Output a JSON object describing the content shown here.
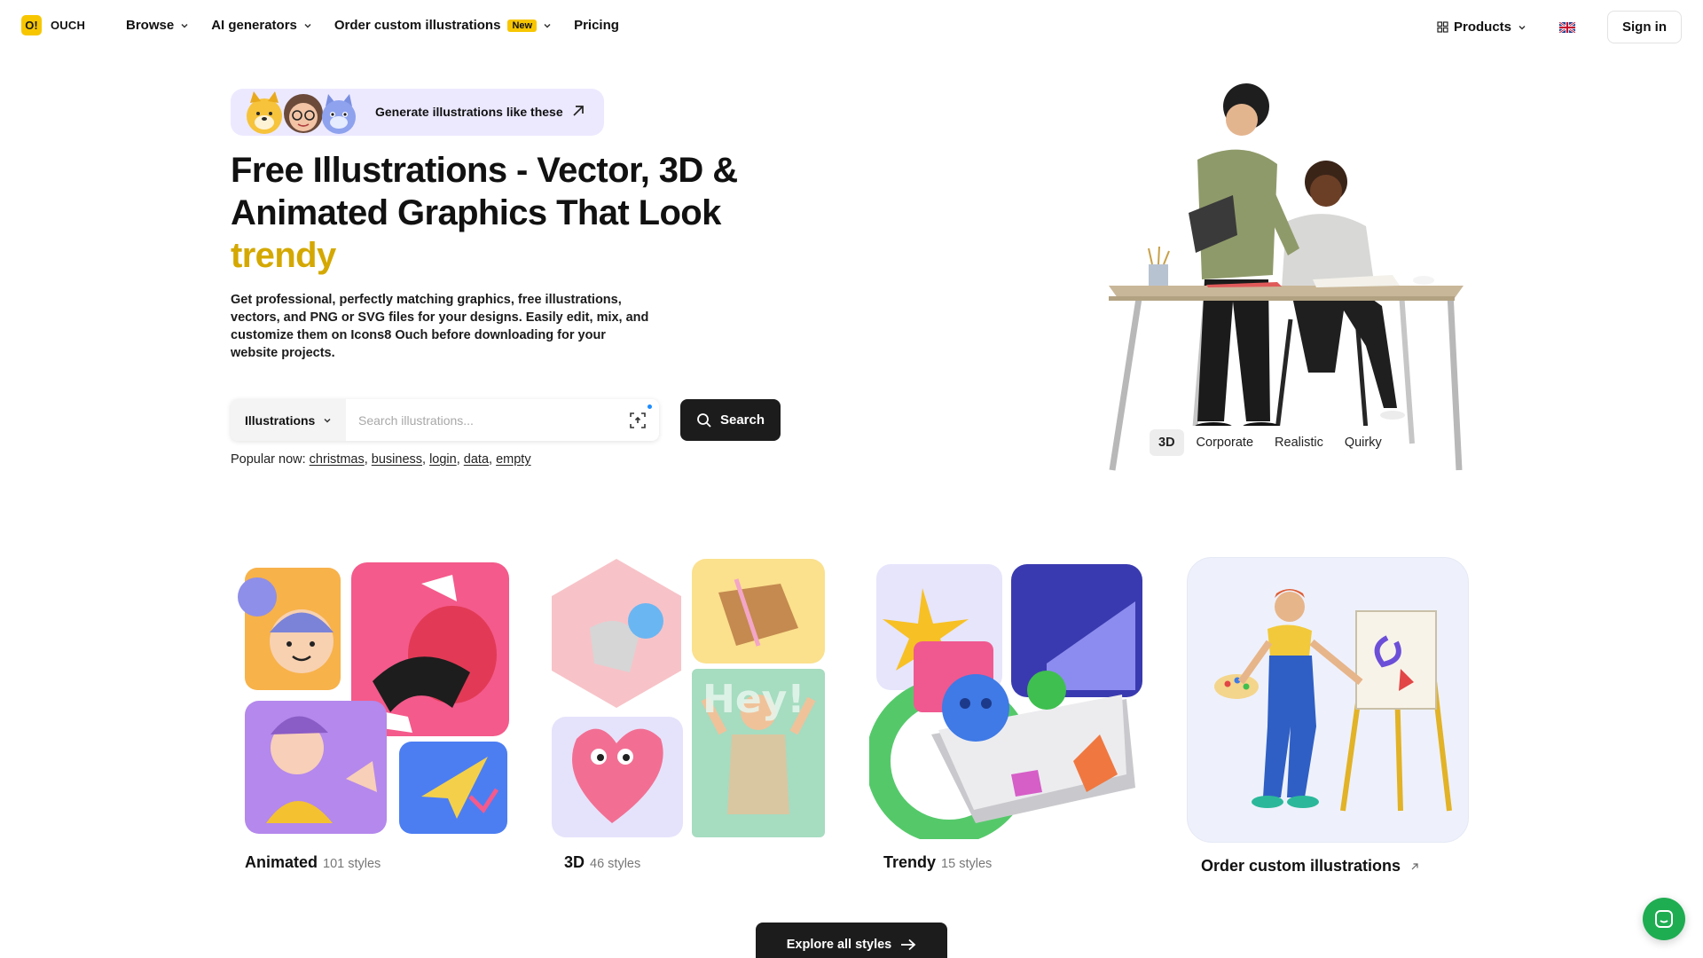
{
  "nav": {
    "logo_mark": "O!",
    "logo_text": "OUCH",
    "links": [
      {
        "label": "Browse"
      },
      {
        "label": "AI generators"
      },
      {
        "label": "Order custom illustrations",
        "badge": "New"
      },
      {
        "label": "Pricing"
      }
    ],
    "products_label": "Products",
    "language_icon": "uk-flag-icon",
    "signin_label": "Sign in"
  },
  "hero": {
    "pill_text": "Generate illustrations like these",
    "headline_main": "Free Illustrations - Vector, 3D & Animated Graphics That Look ",
    "headline_accent": "trendy",
    "subtext": "Get professional, perfectly matching graphics, free illustrations, vectors, and PNG or SVG files for your designs. Easily edit, mix, and customize them on Icons8 Ouch before downloading for your website projects.",
    "search": {
      "type_label": "Illustrations",
      "placeholder": "Search illustrations...",
      "button_label": "Search"
    },
    "popular_label": "Popular now:",
    "popular": [
      "christmas",
      "business",
      "login",
      "data",
      "empty"
    ],
    "style_tabs": [
      "3D",
      "Corporate",
      "Realistic",
      "Quirky"
    ],
    "active_style_tab": "3D"
  },
  "categories": [
    {
      "title": "Animated",
      "count": "101 styles"
    },
    {
      "title": "3D",
      "count": "46 styles"
    },
    {
      "title": "Trendy",
      "count": "15 styles"
    }
  ],
  "custom_card": {
    "title": "Order custom illustrations"
  },
  "explore_label": "Explore all styles",
  "colors": {
    "accent": "#d4a800",
    "badge": "#f7c600",
    "dark": "#1c1c1c",
    "pill_bg": "#ece9ff",
    "chat": "#1fad52"
  }
}
